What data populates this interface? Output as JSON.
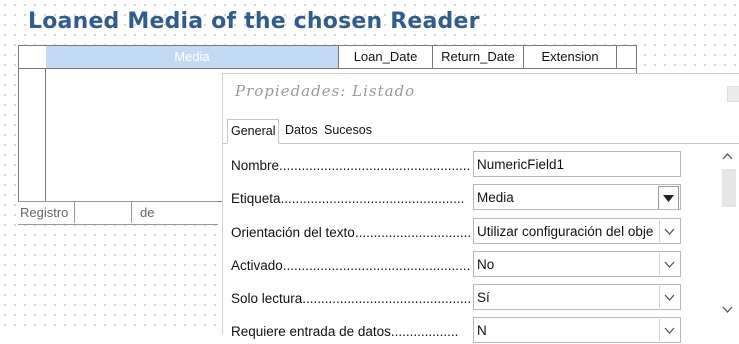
{
  "form": {
    "title": "Loaned Media of the chosen Reader",
    "columns": [
      "Media",
      "Loan_Date",
      "Return_Date",
      "Extension"
    ],
    "navigator": {
      "record_label": "Registro",
      "of_label": "de"
    }
  },
  "dialog": {
    "title": "Propiedades: Listado",
    "tabs": [
      "General",
      "Datos",
      "Sucesos"
    ],
    "active_tab": "General",
    "properties": [
      {
        "label": "Nombre....................................................",
        "value": "NumericField1",
        "control": "text"
      },
      {
        "label": "Etiqueta.................................................",
        "value": "Media",
        "control": "dropdown-solid"
      },
      {
        "label": "Orientación del texto...............................",
        "value": "Utilizar configuración del obje",
        "control": "dropdown"
      },
      {
        "label": "Activado..................................................",
        "value": "No",
        "control": "dropdown"
      },
      {
        "label": "Solo lectura.............................................",
        "value": "Sí",
        "control": "dropdown"
      },
      {
        "label": "Requiere entrada de datos..................",
        "value": "N",
        "control": "dropdown"
      }
    ]
  },
  "colors": {
    "title": "#2f5d91",
    "selected_column": "#c3daf4"
  }
}
